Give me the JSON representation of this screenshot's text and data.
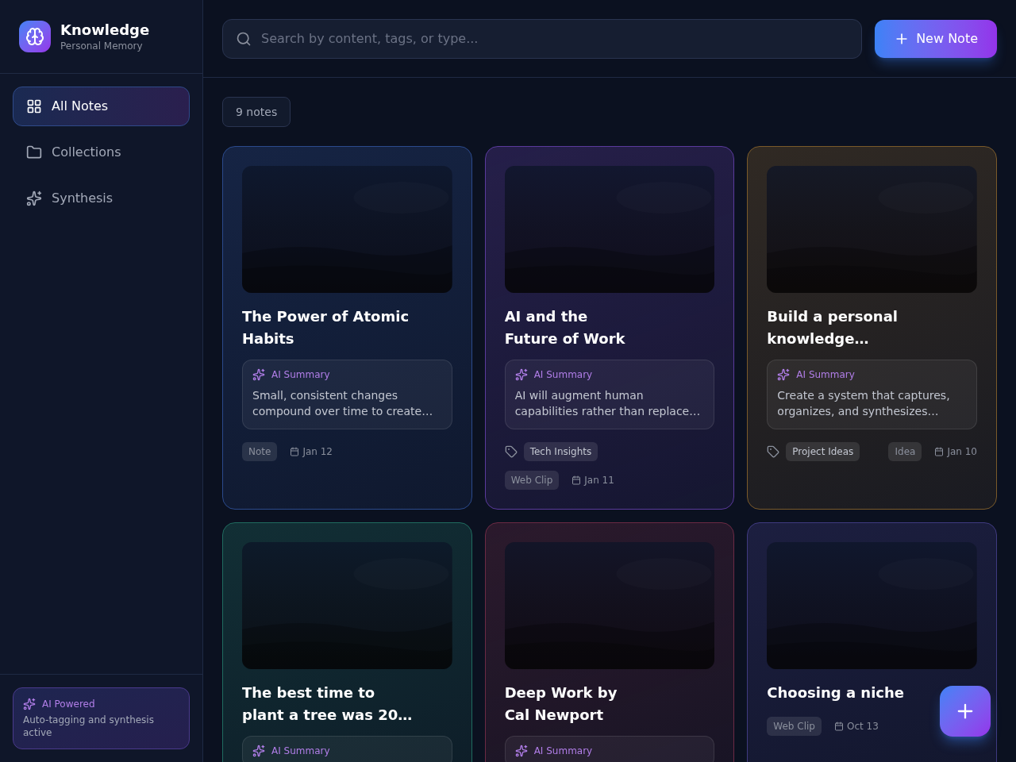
{
  "app": {
    "title": "Knowledge",
    "subtitle": "Personal Memory"
  },
  "nav": [
    {
      "label": "All Notes",
      "kind": "grid",
      "selected": true
    },
    {
      "label": "Collections",
      "kind": "folder",
      "selected": false
    },
    {
      "label": "Synthesis",
      "kind": "sparkles",
      "selected": false
    }
  ],
  "ai_status": {
    "title": "AI Powered",
    "text": "Auto-tagging and synthesis active"
  },
  "search": {
    "placeholder": "Search by content, tags, or type..."
  },
  "new_note_button": "New Note",
  "count": "9 notes",
  "notes": [
    {
      "title": "The Power of Atomic Habits",
      "color": "#2b4a8c",
      "summary": {
        "label": "AI Summary",
        "text": "Small, consistent changes compound over time to create…"
      },
      "type": "Note",
      "date": "Jan 12"
    },
    {
      "title": "AI and the\nFuture of Work",
      "color": "#5a3a9c",
      "summary": {
        "label": "AI Summary",
        "text": "AI will augment human capabilities rather than replace…"
      },
      "tags": [
        "Tech Insights"
      ],
      "type": "Web Clip",
      "date": "Jan 11"
    },
    {
      "title": "Build a personal knowledge…",
      "color": "#7a5a2a",
      "summary": {
        "label": "AI Summary",
        "text": "Create a system that captures, organizes, and synthesizes…"
      },
      "tags": [
        "Project Ideas"
      ],
      "type": "Idea",
      "date": "Jan 10"
    },
    {
      "title": "The best time to\nplant a tree was 20…",
      "color": "#1f6b5f",
      "summary": {
        "label": "AI Summary"
      }
    },
    {
      "title": "Deep Work by\nCal Newport",
      "color": "#6b2a44",
      "summary": {
        "label": "AI Summary"
      }
    },
    {
      "title": "Choosing a niche",
      "color": "#3f3a80",
      "type": "Web Clip",
      "date": "Oct 13"
    }
  ]
}
